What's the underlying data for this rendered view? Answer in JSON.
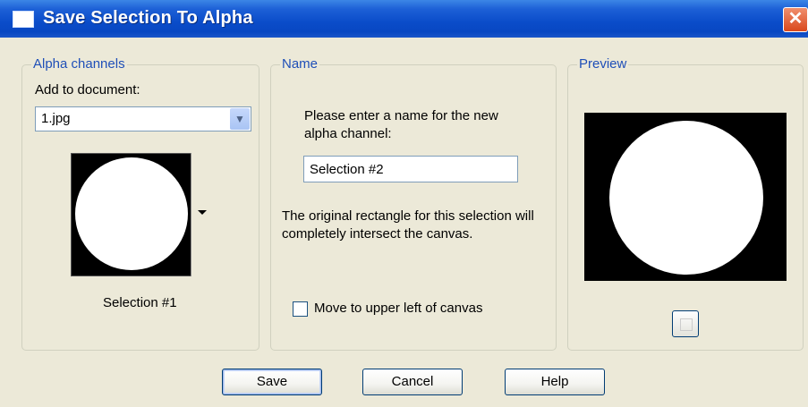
{
  "window": {
    "title": "Save Selection To Alpha",
    "close_glyph": "✕"
  },
  "alpha_channels": {
    "group_label": "Alpha channels",
    "add_to_document_label": "Add to document:",
    "document_select_value": "1.jpg",
    "thumbnail_label": "Selection #1"
  },
  "name": {
    "group_label": "Name",
    "instruction": "Please enter a name for the new alpha channel:",
    "name_input_value": "Selection #2",
    "info_text": "The original rectangle for this selection will completely intersect the canvas.",
    "move_checkbox_label": "Move to upper left of canvas",
    "move_checkbox_checked": false
  },
  "preview": {
    "group_label": "Preview"
  },
  "buttons": {
    "save": "Save",
    "cancel": "Cancel",
    "help": "Help"
  },
  "colors": {
    "title_bar": "#0a4cc9",
    "dialog_bg": "#ece9d8",
    "group_label": "#1f4fb8",
    "close_button": "#d9481c"
  },
  "icons": {
    "window": "window-icon",
    "close": "close-icon",
    "dropdown": "chevron-down-icon",
    "preview_toggle": "preview-toggle-icon"
  }
}
